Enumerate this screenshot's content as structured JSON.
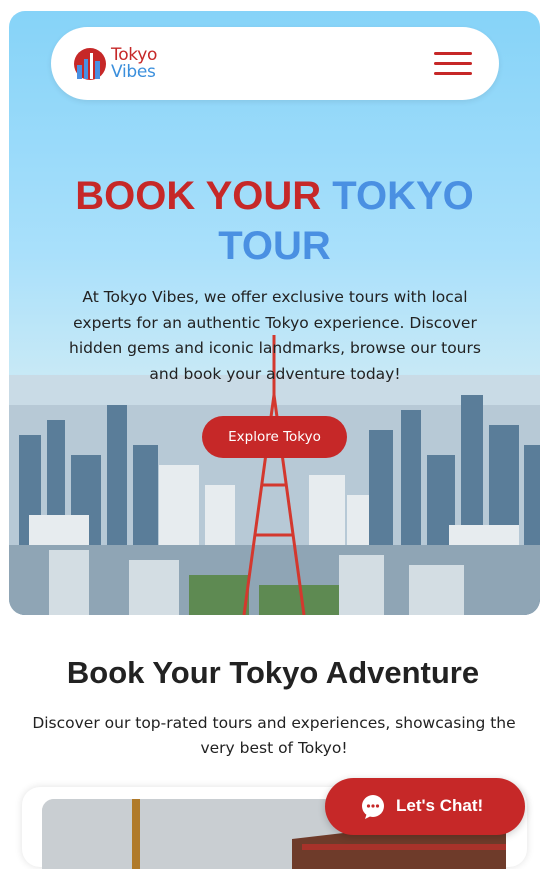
{
  "header": {
    "logo_line1": "Tokyo",
    "logo_line2": "Vibes",
    "menu_icon": "hamburger-icon"
  },
  "hero": {
    "title_part1": "BOOK YOUR ",
    "title_part2": "TOKYO",
    "title_part3": "TOUR",
    "description": "At Tokyo Vibes, we offer exclusive tours with local experts for an authentic Tokyo experience. Discover hidden gems and iconic landmarks, browse our tours and book your adventure today!",
    "cta_label": "Explore Tokyo"
  },
  "adventure": {
    "title": "Book Your Tokyo Adventure",
    "description": "Discover our top-rated tours and experiences, showcasing the very best of Tokyo!"
  },
  "chat": {
    "label": "Let's Chat!",
    "icon": "chat-bubble-icon"
  },
  "colors": {
    "brand_red": "#c62828",
    "brand_blue": "#4a90e2"
  }
}
